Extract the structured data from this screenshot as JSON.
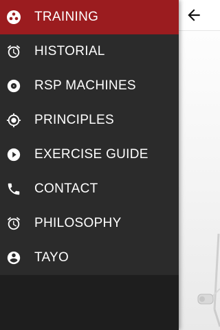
{
  "colors": {
    "drawer_bg": "#2b2b2b",
    "drawer_bottom_bg": "#1e1e1e",
    "active_bg": "#9b1c1f",
    "text": "#ffffff"
  },
  "header": {
    "back_icon": "arrow-back-icon"
  },
  "menu": {
    "items": [
      {
        "label": "TRAINING",
        "icon": "dots-circle-icon",
        "active": true
      },
      {
        "label": "HISTORIAL",
        "icon": "alarm-clock-icon",
        "active": false
      },
      {
        "label": "RSP MACHINES",
        "icon": "disc-icon",
        "active": false
      },
      {
        "label": "PRINCIPLES",
        "icon": "crosshair-icon",
        "active": false
      },
      {
        "label": "EXERCISE GUIDE",
        "icon": "play-circle-icon",
        "active": false
      },
      {
        "label": "CONTACT",
        "icon": "phone-icon",
        "active": false
      },
      {
        "label": "PHILOSOPHY",
        "icon": "alarm-clock-icon",
        "active": false
      },
      {
        "label": "TAYO",
        "icon": "account-circle-icon",
        "active": false
      }
    ]
  }
}
